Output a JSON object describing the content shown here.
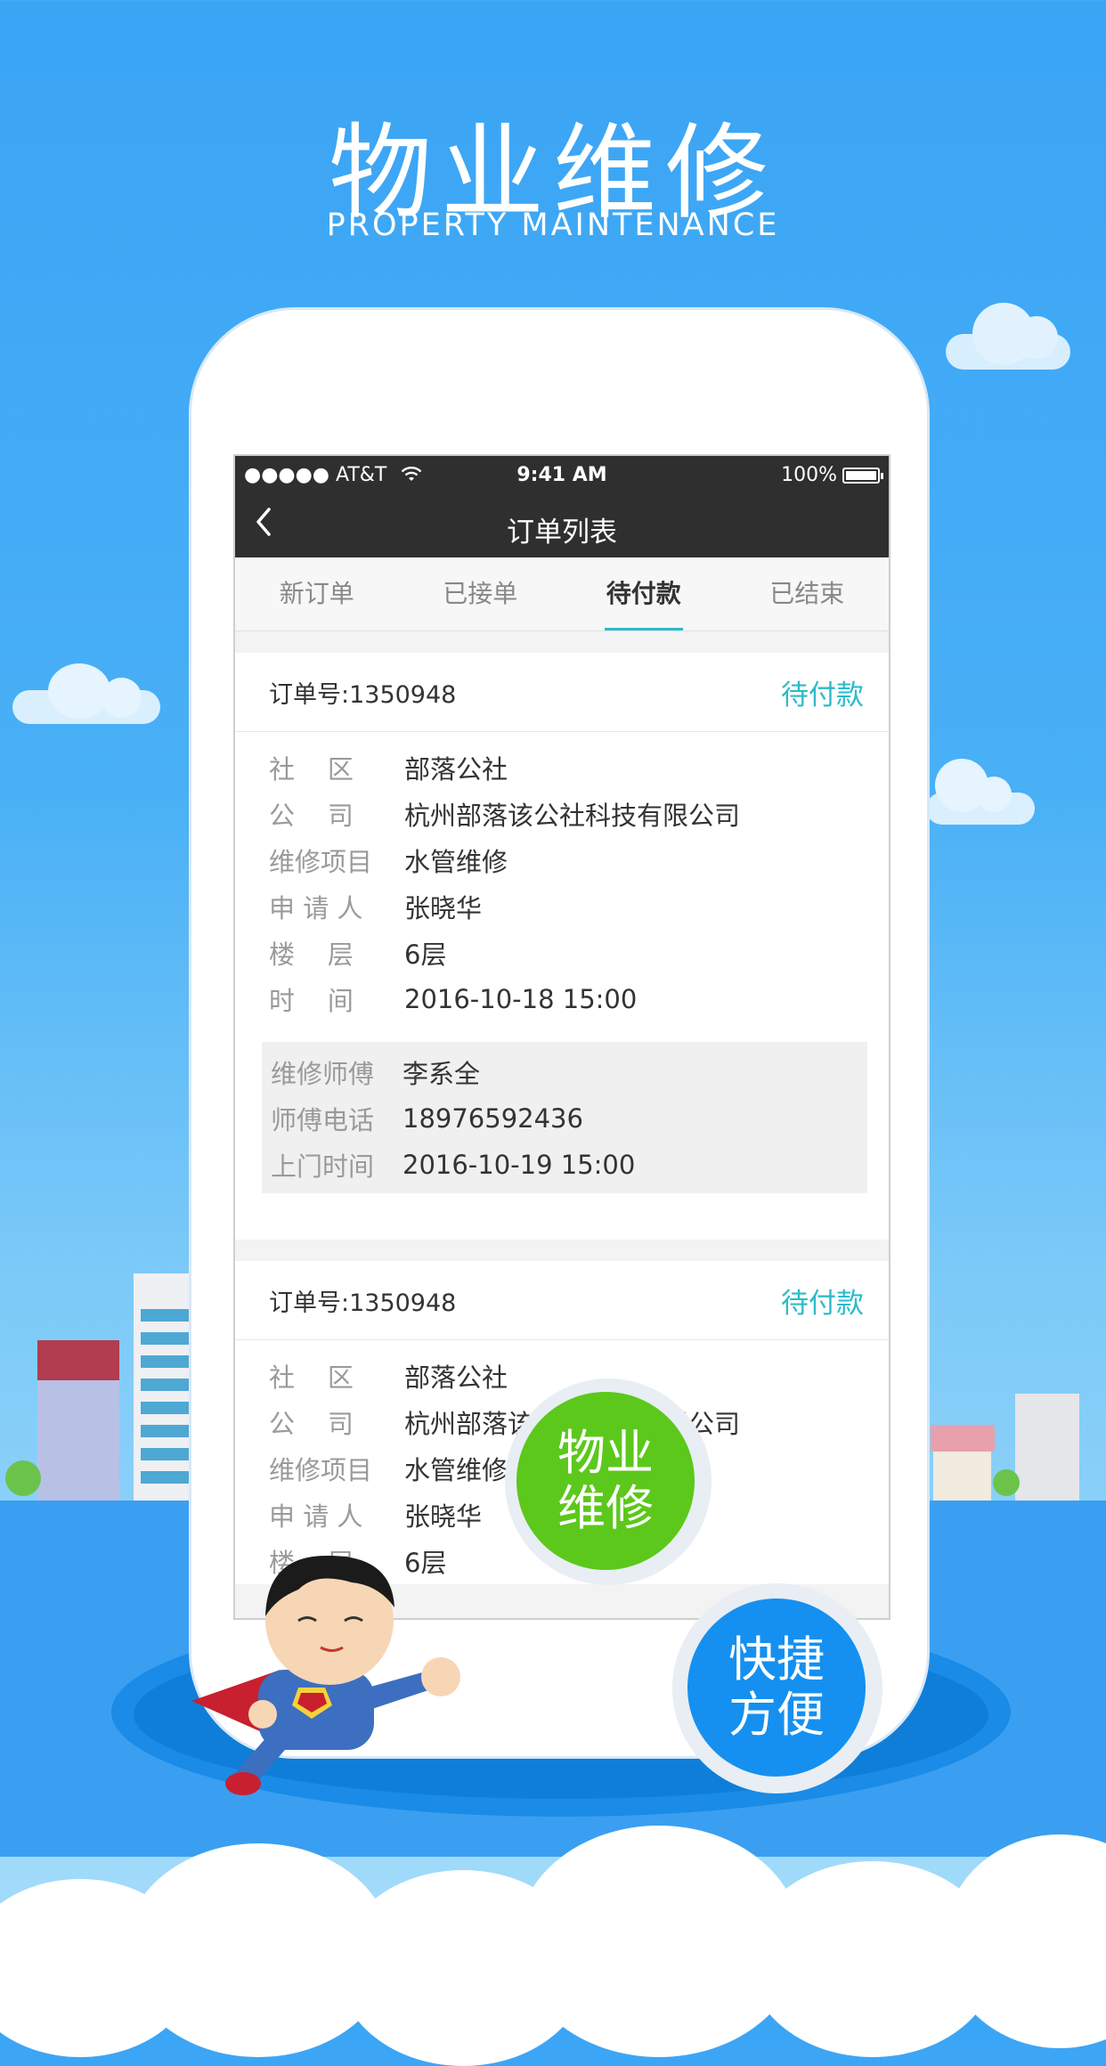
{
  "hero": {
    "title": "物业维修",
    "subtitle": "PROPERTY MAINTENANCE"
  },
  "statusbar": {
    "carrier": "●●●●● AT&T",
    "time": "9:41 AM",
    "battery": "100%"
  },
  "navbar": {
    "title": "订单列表"
  },
  "tabs": [
    {
      "label": "新订单"
    },
    {
      "label": "已接单"
    },
    {
      "label": "待付款"
    },
    {
      "label": "已结束"
    }
  ],
  "orders": [
    {
      "order_no": "订单号:1350948",
      "status": "待付款",
      "fields": [
        {
          "label": "社    区",
          "value": "部落公社"
        },
        {
          "label": "公    司",
          "value": "杭州部落该公社科技有限公司"
        },
        {
          "label": "维修项目",
          "value": "水管维修"
        },
        {
          "label": "申 请 人",
          "value": "张晓华"
        },
        {
          "label": "楼    层",
          "value": "6层"
        },
        {
          "label": "时    间",
          "value": "2016-10-18   15:00"
        }
      ],
      "technician": [
        {
          "label": "维修师傅",
          "value": "李系全"
        },
        {
          "label": "师傅电话",
          "value": "18976592436"
        },
        {
          "label": "上门时间",
          "value": "2016-10-19   15:00"
        }
      ]
    },
    {
      "order_no": "订单号:1350948",
      "status": "待付款",
      "fields": [
        {
          "label": "社    区",
          "value": "部落公社"
        },
        {
          "label": "公    司",
          "value": "杭州部落该公社科技有限公司"
        },
        {
          "label": "维修项目",
          "value": "水管维修"
        },
        {
          "label": "申 请 人",
          "value": "张晓华"
        },
        {
          "label": "楼    层",
          "value": "6层"
        }
      ]
    }
  ],
  "badges": {
    "green_line1": "物业",
    "green_line2": "维修",
    "blue_line1": "快捷",
    "blue_line2": "方便"
  },
  "colors": {
    "accent": "#2bbbc9",
    "sky": "#3aa4f5",
    "green_badge": "#5cc81b",
    "blue_badge": "#1590f0"
  }
}
